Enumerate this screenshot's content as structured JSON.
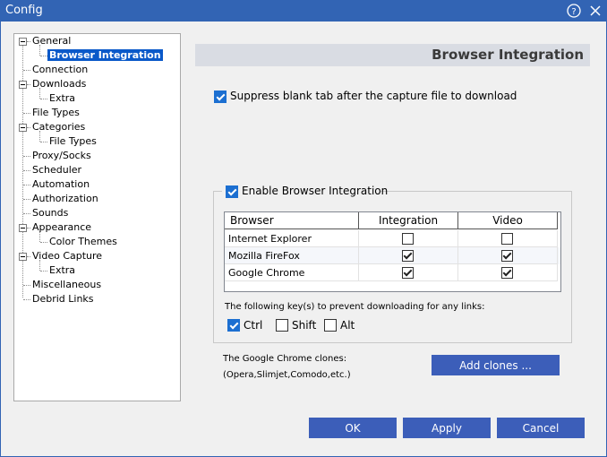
{
  "window": {
    "title": "Config"
  },
  "titlebar": {
    "help_icon": "?",
    "close_icon": "✕"
  },
  "tree": {
    "items": [
      {
        "label": "General"
      },
      {
        "label": "Browser Integration"
      },
      {
        "label": "Connection"
      },
      {
        "label": "Downloads"
      },
      {
        "label": "Extra"
      },
      {
        "label": "File Types"
      },
      {
        "label": "Categories"
      },
      {
        "label": "File Types"
      },
      {
        "label": "Proxy/Socks"
      },
      {
        "label": "Scheduler"
      },
      {
        "label": "Automation"
      },
      {
        "label": "Authorization"
      },
      {
        "label": "Sounds"
      },
      {
        "label": "Appearance"
      },
      {
        "label": "Color Themes"
      },
      {
        "label": "Video Capture"
      },
      {
        "label": "Extra"
      },
      {
        "label": "Miscellaneous"
      },
      {
        "label": "Debrid Links"
      }
    ]
  },
  "panel": {
    "title": "Browser Integration",
    "suppress_label": "Suppress blank tab after the capture file to download",
    "enable_label": "Enable Browser Integration",
    "table": {
      "headers": [
        "Browser",
        "Integration",
        "Video"
      ],
      "rows": [
        {
          "browser": "Internet Explorer",
          "integration": false,
          "video": false
        },
        {
          "browser": "Mozilla FireFox",
          "integration": true,
          "video": true
        },
        {
          "browser": "Google Chrome",
          "integration": true,
          "video": true
        }
      ]
    },
    "keys_label": "The following key(s) to prevent downloading for any links:",
    "keys": {
      "ctrl": "Ctrl",
      "shift": "Shift",
      "alt": "Alt"
    },
    "clones_label": "The Google Chrome clones:",
    "clones_examples": "(Opera,Slimjet,Comodo,etc.)",
    "add_clones_label": "Add clones ..."
  },
  "footer": {
    "ok": "OK",
    "apply": "Apply",
    "cancel": "Cancel"
  }
}
